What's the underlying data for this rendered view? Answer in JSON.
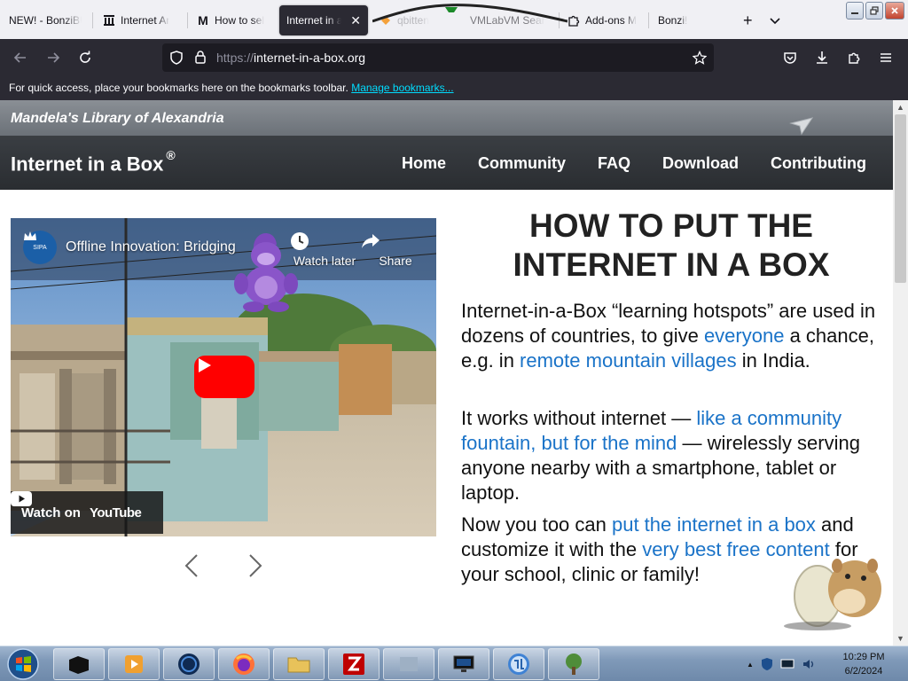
{
  "browser": {
    "tabs": [
      {
        "title": "NEW! - BonziBU",
        "icon": "bonzi-icon",
        "active": false
      },
      {
        "title": "Internet Ar",
        "icon": "archive-icon",
        "active": false
      },
      {
        "title": "How to sel",
        "icon": "m-logo-icon",
        "active": false
      },
      {
        "title": "Internet in a b",
        "icon": "none",
        "active": true
      },
      {
        "title": "qbitten",
        "icon": "qbittorrent-icon",
        "active": false
      },
      {
        "title": "VMLabVM Sear",
        "icon": "search-icon",
        "active": false
      },
      {
        "title": "Add-ons M",
        "icon": "puzzle-icon",
        "active": false
      },
      {
        "title": "Bonzi!",
        "icon": "none",
        "active": false
      }
    ],
    "new_tab_symbol": "+",
    "list_tabs_symbol": "⌄",
    "url": {
      "scheme": "https://",
      "host": "internet-in-a-box.org"
    },
    "bookmarks_bar": {
      "message": "For quick access, place your bookmarks here on the bookmarks toolbar.",
      "manage_link": "Manage bookmarks..."
    }
  },
  "site": {
    "banner_title": "Mandela's Library of Alexandria",
    "name": "Internet in a Box",
    "registered": "®",
    "nav": [
      "Home",
      "Community",
      "FAQ",
      "Download",
      "Contributing"
    ]
  },
  "video": {
    "title": "Offline Innovation: Bridging",
    "channel_badge": "SIPA",
    "watch_later": "Watch later",
    "share": "Share",
    "watch_on": "Watch on",
    "youtube": "YouTube"
  },
  "article": {
    "heading_line1": "HOW TO PUT THE",
    "heading_line2": "INTERNET IN A BOX",
    "p1": {
      "t1": "Internet-in-a-Box “learning hotspots” are used in dozens of countries, to give ",
      "l1": "everyone",
      "t2": " a chance, e.g. in ",
      "l2": "remote mountain villages",
      "t3": " in India."
    },
    "p2": {
      "t1": "It works without internet — ",
      "l1": "like a community fountain, but for the mind",
      "t2": " — wirelessly serving anyone nearby with a smartphone, tablet or laptop."
    },
    "p3": {
      "t1": "Now you too can ",
      "l1": "put the internet in a box",
      "t2": " and customize it with the ",
      "l2": "very best free content",
      "t3": " for your school, clinic or family!"
    }
  },
  "taskbar": {
    "apps": [
      "media-player",
      "browser-globe",
      "firefox",
      "file-explorer",
      "filezilla",
      "app-gray",
      "virtual-machine",
      "qbittorrent",
      "tree-app"
    ],
    "clock_time": "10:29 PM",
    "clock_date": "6/2/2024"
  },
  "colors": {
    "link": "#1a73c8",
    "chrome_dark": "#2b2a33",
    "youtube_red": "#ff0000",
    "bonzi_purple": "#8a55c9"
  }
}
